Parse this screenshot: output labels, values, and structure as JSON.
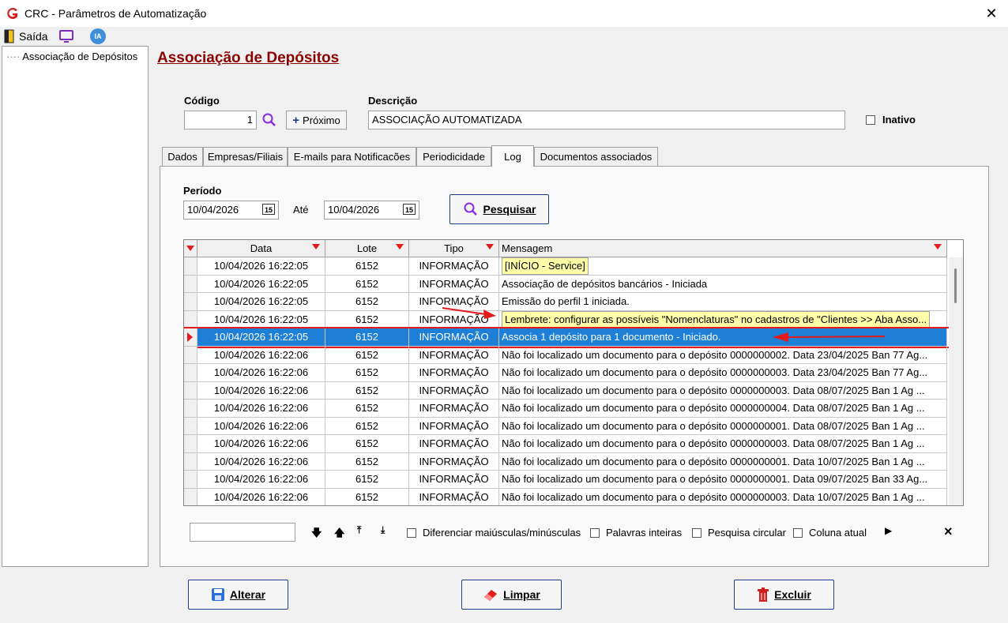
{
  "window": {
    "title": "CRC - Parâmetros de Automatização",
    "close_glyph": "✕"
  },
  "toolbar": {
    "exit_label": "Saída",
    "ia_label": "IA"
  },
  "tree": {
    "item": "Associação de Depósitos"
  },
  "page_title": "Associação de Depósitos",
  "codigo": {
    "label": "Código",
    "value": "1",
    "next_label": "Próximo"
  },
  "descricao": {
    "label": "Descrição",
    "value": "ASSOCIAÇÃO AUTOMATIZADA"
  },
  "inativo": {
    "label": "Inativo",
    "checked": false
  },
  "tabs": [
    {
      "label": "Dados",
      "active": false
    },
    {
      "label": "Empresas/Filiais",
      "active": false
    },
    {
      "label": "E-mails para Notificacões",
      "active": false
    },
    {
      "label": "Periodicidade",
      "active": false
    },
    {
      "label": "Log",
      "active": true
    },
    {
      "label": "Documentos associados",
      "active": false
    }
  ],
  "periodo": {
    "label": "Período",
    "from": "10/04/2026",
    "to_label": "Até",
    "to": "10/04/2026",
    "cal_glyph": "15"
  },
  "search_button": "Pesquisar",
  "grid": {
    "columns": [
      "Data",
      "Lote",
      "Tipo",
      "Mensagem"
    ],
    "rows": [
      {
        "data": "10/04/2026 16:22:05",
        "lote": "6152",
        "tipo": "INFORMAÇÃO",
        "msg": "[INÍCIO - Service]",
        "highlight": true
      },
      {
        "data": "10/04/2026 16:22:05",
        "lote": "6152",
        "tipo": "INFORMAÇÃO",
        "msg": "Associação de depósitos bancários - Iniciada"
      },
      {
        "data": "10/04/2026 16:22:05",
        "lote": "6152",
        "tipo": "INFORMAÇÃO",
        "msg": "Emissão do perfil 1 iniciada."
      },
      {
        "data": "10/04/2026 16:22:05",
        "lote": "6152",
        "tipo": "INFORMAÇÃO",
        "msg": "Lembrete: configurar as possíveis \"Nomenclaturas\" no cadastros de \"Clientes >> Aba Asso...",
        "highlight": true
      },
      {
        "data": "10/04/2026 16:22:05",
        "lote": "6152",
        "tipo": "INFORMAÇÃO",
        "msg": "Associa 1 depósito para 1 documento - Iniciado.",
        "selected": true
      },
      {
        "data": "10/04/2026 16:22:06",
        "lote": "6152",
        "tipo": "INFORMAÇÃO",
        "msg": "Não foi localizado um documento para o depósito 0000000002. Data 23/04/2025 Ban 77 Ag..."
      },
      {
        "data": "10/04/2026 16:22:06",
        "lote": "6152",
        "tipo": "INFORMAÇÃO",
        "msg": "Não foi localizado um documento para o depósito 0000000003. Data 23/04/2025 Ban 77 Ag..."
      },
      {
        "data": "10/04/2026 16:22:06",
        "lote": "6152",
        "tipo": "INFORMAÇÃO",
        "msg": "Não foi localizado um documento para o depósito 0000000003. Data 08/07/2025 Ban 1 Ag ..."
      },
      {
        "data": "10/04/2026 16:22:06",
        "lote": "6152",
        "tipo": "INFORMAÇÃO",
        "msg": "Não foi localizado um documento para o depósito 0000000004. Data 08/07/2025 Ban 1 Ag ..."
      },
      {
        "data": "10/04/2026 16:22:06",
        "lote": "6152",
        "tipo": "INFORMAÇÃO",
        "msg": "Não foi localizado um documento para o depósito 0000000001. Data 08/07/2025 Ban 1 Ag ..."
      },
      {
        "data": "10/04/2026 16:22:06",
        "lote": "6152",
        "tipo": "INFORMAÇÃO",
        "msg": "Não foi localizado um documento para o depósito 0000000003. Data 08/07/2025 Ban 1 Ag ..."
      },
      {
        "data": "10/04/2026 16:22:06",
        "lote": "6152",
        "tipo": "INFORMAÇÃO",
        "msg": "Não foi localizado um documento para o depósito 0000000001. Data 10/07/2025 Ban 1 Ag ..."
      },
      {
        "data": "10/04/2026 16:22:06",
        "lote": "6152",
        "tipo": "INFORMAÇÃO",
        "msg": "Não foi localizado um documento para o depósito 0000000001. Data 09/07/2025 Ban 33 Ag..."
      },
      {
        "data": "10/04/2026 16:22:06",
        "lote": "6152",
        "tipo": "INFORMAÇÃO",
        "msg": "Não foi localizado um documento para o depósito 0000000003. Data 10/07/2025 Ban 1 Ag ..."
      }
    ]
  },
  "search_bar": {
    "case_label": "Diferenciar maiúsculas/minúsculas",
    "whole_label": "Palavras inteiras",
    "circular_label": "Pesquisa circular",
    "column_label": "Coluna atual",
    "close_glyph": "×"
  },
  "actions": {
    "alterar": "Alterar",
    "limpar": "Limpar",
    "excluir": "Excluir"
  },
  "colors": {
    "selected_row": "#1e7fd6",
    "highlight_cell": "#ffffa8",
    "title_red": "#8b0000",
    "annotation_red": "#e31b1b"
  }
}
